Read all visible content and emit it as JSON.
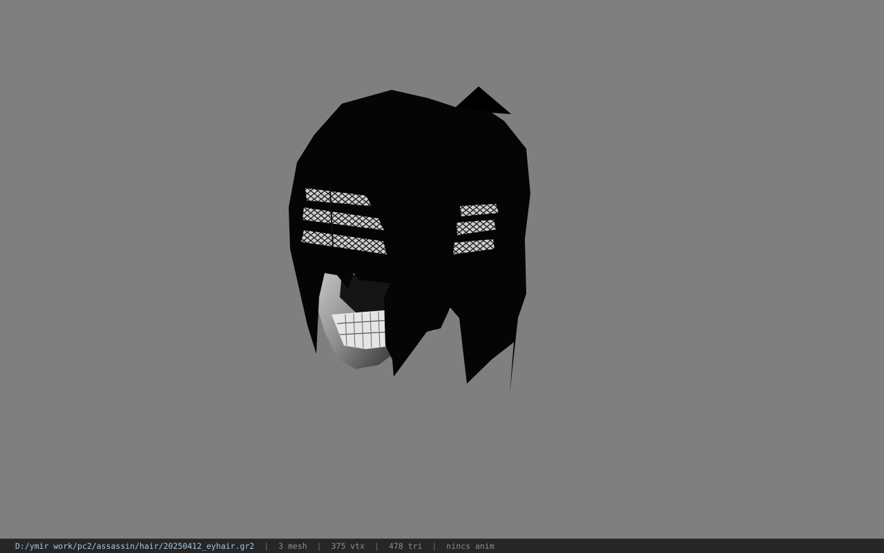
{
  "viewer": {
    "background_color": "#7f7f7f",
    "model_icon": "hair-mesh-model"
  },
  "status": {
    "file_path": "D:/ymir work/pc2/assassin/hair/20250412_eyhair.gr2",
    "mesh_count": "3 mesh",
    "vertex_count": "375 vtx",
    "triangle_count": "478 tri",
    "anim_status": "nincs anim",
    "separator": "|"
  }
}
